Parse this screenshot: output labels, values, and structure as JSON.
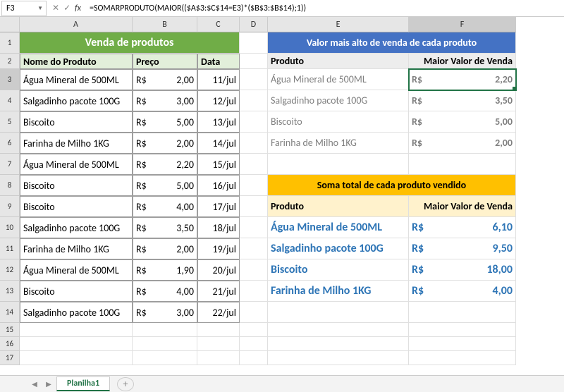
{
  "name_box": "F3",
  "formula": "=SOMARPRODUTO(MAIOR(($A$3:$C$14=E3)*($B$3:$B$14);1))",
  "columns": [
    "A",
    "B",
    "C",
    "D",
    "E",
    "F"
  ],
  "rows": [
    "1",
    "2",
    "3",
    "4",
    "5",
    "6",
    "7",
    "8",
    "9",
    "10",
    "11",
    "12",
    "13",
    "14",
    "15",
    "16",
    "17"
  ],
  "green_title": "Venda de produtos",
  "green_headers": {
    "a": "Nome do Produto",
    "b": "Preço",
    "c": "Data"
  },
  "sales": [
    {
      "name": "Água Mineral de 500ML",
      "cur": "R$",
      "price": "2,00",
      "date": "11/jul"
    },
    {
      "name": "Salgadinho pacote 100G",
      "cur": "R$",
      "price": "3,00",
      "date": "12/jul"
    },
    {
      "name": "Biscoito",
      "cur": "R$",
      "price": "5,00",
      "date": "13/jul"
    },
    {
      "name": "Farinha de Milho 1KG",
      "cur": "R$",
      "price": "2,00",
      "date": "14/jul"
    },
    {
      "name": "Água Mineral de 500ML",
      "cur": "R$",
      "price": "2,20",
      "date": "15/jul"
    },
    {
      "name": "Biscoito",
      "cur": "R$",
      "price": "5,00",
      "date": "16/jul"
    },
    {
      "name": "Biscoito",
      "cur": "R$",
      "price": "4,00",
      "date": "17/jul"
    },
    {
      "name": "Salgadinho pacote 100G",
      "cur": "R$",
      "price": "3,50",
      "date": "18/jul"
    },
    {
      "name": "Farinha de Milho 1KG",
      "cur": "R$",
      "price": "2,00",
      "date": "19/jul"
    },
    {
      "name": "Água Mineral de 500ML",
      "cur": "R$",
      "price": "1,90",
      "date": "20/jul"
    },
    {
      "name": "Biscoito",
      "cur": "R$",
      "price": "4,00",
      "date": "21/jul"
    },
    {
      "name": "Salgadinho pacote 100G",
      "cur": "R$",
      "price": "3,00",
      "date": "22/jul"
    }
  ],
  "blue_title": "Valor mais alto de venda de cada produto",
  "blue_headers": {
    "e": "Produto",
    "f": "Maior Valor de Venda"
  },
  "highest": [
    {
      "name": "Água Mineral de 500ML",
      "cur": "R$",
      "price": "2,20"
    },
    {
      "name": "Salgadinho pacote 100G",
      "cur": "R$",
      "price": "3,50"
    },
    {
      "name": "Biscoito",
      "cur": "R$",
      "price": "5,00"
    },
    {
      "name": "Farinha de Milho 1KG",
      "cur": "R$",
      "price": "2,00"
    }
  ],
  "orange_title": "Soma total de cada produto vendido",
  "orange_headers": {
    "e": "Produto",
    "f": "Maior Valor de Venda"
  },
  "totals": [
    {
      "name": "Água Mineral de 500ML",
      "cur": "R$",
      "price": "6,10"
    },
    {
      "name": "Salgadinho pacote 100G",
      "cur": "R$",
      "price": "9,50"
    },
    {
      "name": "Biscoito",
      "cur": "R$",
      "price": "18,00"
    },
    {
      "name": "Farinha de Milho 1KG",
      "cur": "R$",
      "price": "4,00"
    }
  ],
  "sheet_tab": "Planilha1",
  "chart_data": [
    {
      "type": "table",
      "title": "Venda de produtos",
      "columns": [
        "Nome do Produto",
        "Preço (R$)",
        "Data"
      ],
      "rows": [
        [
          "Água Mineral de 500ML",
          2.0,
          "11/jul"
        ],
        [
          "Salgadinho pacote 100G",
          3.0,
          "12/jul"
        ],
        [
          "Biscoito",
          5.0,
          "13/jul"
        ],
        [
          "Farinha de Milho 1KG",
          2.0,
          "14/jul"
        ],
        [
          "Água Mineral de 500ML",
          2.2,
          "15/jul"
        ],
        [
          "Biscoito",
          5.0,
          "16/jul"
        ],
        [
          "Biscoito",
          4.0,
          "17/jul"
        ],
        [
          "Salgadinho pacote 100G",
          3.5,
          "18/jul"
        ],
        [
          "Farinha de Milho 1KG",
          2.0,
          "19/jul"
        ],
        [
          "Água Mineral de 500ML",
          1.9,
          "20/jul"
        ],
        [
          "Biscoito",
          4.0,
          "21/jul"
        ],
        [
          "Salgadinho pacote 100G",
          3.0,
          "22/jul"
        ]
      ]
    },
    {
      "type": "table",
      "title": "Valor mais alto de venda de cada produto",
      "columns": [
        "Produto",
        "Maior Valor de Venda (R$)"
      ],
      "rows": [
        [
          "Água Mineral de 500ML",
          2.2
        ],
        [
          "Salgadinho pacote 100G",
          3.5
        ],
        [
          "Biscoito",
          5.0
        ],
        [
          "Farinha de Milho 1KG",
          2.0
        ]
      ]
    },
    {
      "type": "table",
      "title": "Soma total de cada produto vendido",
      "columns": [
        "Produto",
        "Maior Valor de Venda (R$)"
      ],
      "rows": [
        [
          "Água Mineral de 500ML",
          6.1
        ],
        [
          "Salgadinho pacote 100G",
          9.5
        ],
        [
          "Biscoito",
          18.0
        ],
        [
          "Farinha de Milho 1KG",
          4.0
        ]
      ]
    }
  ]
}
